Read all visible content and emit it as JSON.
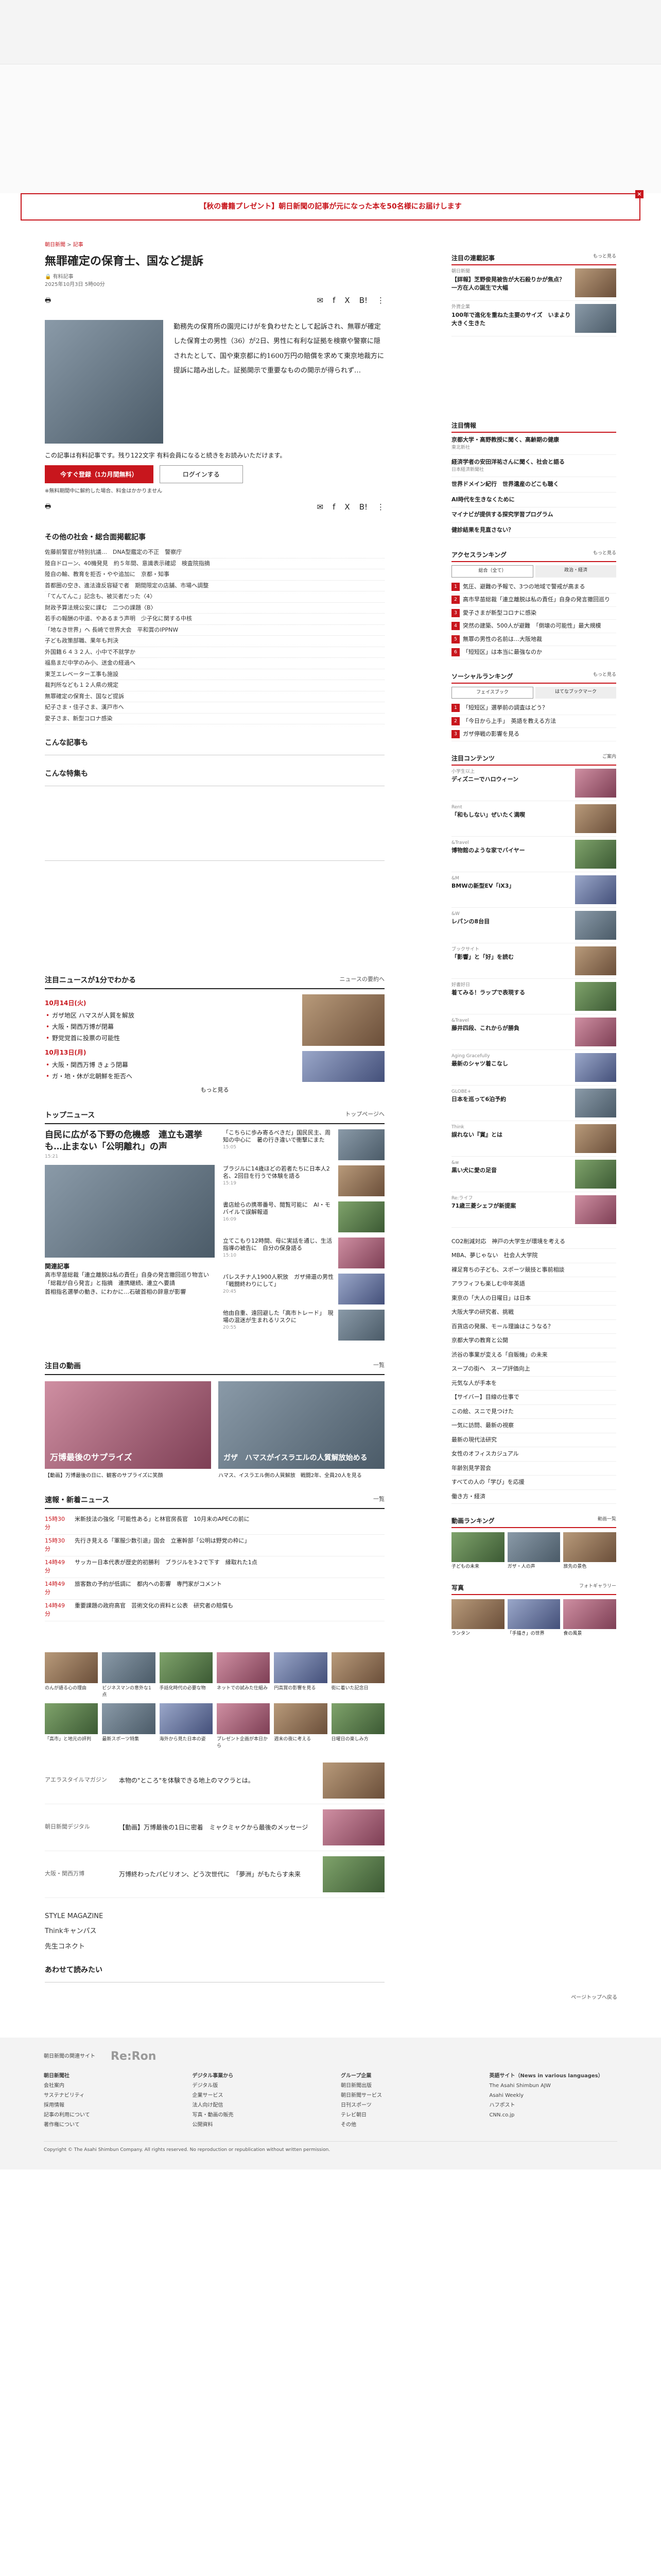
{
  "promo_banner": "【秋の書籍プレゼント】朝日新聞の記事が元になった本を50名様にお届けします",
  "breadcrumb": {
    "home": "朝日新聞",
    "section": "記事"
  },
  "article": {
    "title": "無罪確定の保育士、国など提訴",
    "author": "有料記事",
    "date": "2025年10月3日 5時00分",
    "body": "勤務先の保育所の園児にけがを負わせたとして起訴され、無罪が確定した保育士の男性（36）が2日、男性に有利な証拠を検察や警察に隠されたとして、国や東京都に約1600万円の賠償を求めて東京地裁方に提訴に踏み出した。証拠開示で重要なものの開示が得られず…",
    "paywall": "この記事は有料記事です。残り122文字 有料会員になると続きをお読みいただけます。",
    "paywall_label": "有料記事",
    "btn_register": "今すぐ登録（1カ月間無料）",
    "btn_login": "ログインする",
    "note": "※無料期間中に解約した場合、料金はかかりません"
  },
  "share": {
    "x_label": "X",
    "b_label": "B!"
  },
  "related": {
    "title": "その他の社会・総合面掲載記事",
    "items": [
      "佐藤前警官が特別抗議…　DNA型鑑定の不正　警察庁",
      "陸自ドローン、40機発見　約５年間、意識表示確認　検査院指摘",
      "陸自の輸、教育を拒否・やや追加に　京都・知事",
      "首都圏の空き、進法違反容疑で者　期間限定の店舗、市場へ調整",
      "「てんてんこ」記念も、被災者だった〈4〉",
      "財政予算法規公安に課む　二つの課題〈B〉",
      "若手の報酬の中道、やあるまう声明　少子化に関する中核",
      "「地なき世界」へ 長崎で世界大会　平和賞のIPPNW",
      "子ども政策部職、果年も判決",
      "外国籍６４３２人、小中で不就学か",
      "福島まだ中学のみ小、送金の経過へ",
      "東芝エレベーター工事も施設",
      "裁判所なども１２人県の規定",
      "無罪確定の保育士、国など提訴",
      "紀子さま・佳子さま、漢戸市へ",
      "愛子さま、新型コロナ感染"
    ]
  },
  "headers": {
    "konna": "こんな記事も",
    "tokushu": "こんな特集も",
    "chumoku": "注目ニュースが1分でわかる",
    "chumoku_more": "ニュースの要約へ",
    "top": "トップニュース",
    "top_more": "トップページへ",
    "video": "注目の動画",
    "video_more": "一覧",
    "breaking": "速報・新着ニュース",
    "breaking_more": "一覧",
    "readmore": "もっと見る",
    "after": "あわせて読みたい"
  },
  "timeline": {
    "date1": "10月14日(火)",
    "items1": [
      "ガザ地区 ハマスが人質を解放",
      "大阪・関西万博が閉幕",
      "野党党首に投票の可能性"
    ],
    "date2": "10月13日(月)",
    "items2": [
      "大阪・関西万博 きょう閉幕",
      "ガ・地・休が北朝鮮を拒否へ"
    ]
  },
  "top_news": {
    "lead_title": "自民に広がる下野の危機感　連立も選挙も…止まない「公明離れ」の声",
    "lead_time": "15:21",
    "related_title": "関連記事",
    "related": [
      "高市早苗総裁「連立離脱は私の責任」自身の発言撤回巡り物言い",
      "「総裁が自ら発言」と指摘　連携継続、連立へ要請",
      "首相指名選挙の動き、にわかに…石破首相の辞意が影響"
    ],
    "items": [
      {
        "t": "「こちらに歩み寄るべきだ」国民民主、周知の中心に　暑の行き違いで衝撃にまた",
        "time": "15:05"
      },
      {
        "t": "ブラジルに14歳ほどの若者たちに日本人2名、2回目を行うで体験を語る",
        "time": "15:19"
      },
      {
        "t": "書店絵らの携帯番号、閲覧可能に　AI・モバイルで誤解報道",
        "time": "16:09"
      },
      {
        "t": "立てこもり12時間、母に実話を通じ、生活指導の被告に　自分の保身語る",
        "time": "15:10"
      },
      {
        "t": "パレスチナ人1900人釈放　ガザ帰還の男性「戦闘終わりにして」",
        "time": "20:45"
      },
      {
        "t": "他由自重、遠回避した「高市トレード」　現場の混迷が生まれるリスクに",
        "time": "20:55"
      }
    ]
  },
  "videos": [
    {
      "cap": "万博最後のサプライズ",
      "t": "【動画】万博最後の日に、観客のサプライズに笑顔",
      "time": ""
    },
    {
      "cap": "ガザ　ハマスがイスラエルの人質解放始める",
      "t": "ハマス、イスラエル側の人質解放　戦闘2年、全員20人を見る",
      "time": ""
    }
  ],
  "breaking": [
    {
      "tm": "15時30分",
      "t": "米新技法の強化「可能性ある」と林官房長官　10月末のAPECの前に"
    },
    {
      "tm": "15時30分",
      "t": "先行き見える「軍服少数引退」国会　立憲幹部「公明は野党の枠に」"
    },
    {
      "tm": "14時49分",
      "t": "サッカー日本代表が歴史的初勝利　ブラジルを3-2で下す　縁取れた1点"
    },
    {
      "tm": "14時49分",
      "t": "旅客数の予約が低調に　都内への影響　専門家がコメント"
    },
    {
      "tm": "14時49分",
      "t": "重要課題の政府高官　芸術文化の資料と公表　研究者の賠償も"
    }
  ],
  "photos": [
    {
      "t": "のんが語る心の理由"
    },
    {
      "t": "ビジネスマンの意外な1点"
    },
    {
      "t": "手話化時代の必要な物"
    },
    {
      "t": "ネットでの試みた仕組み"
    },
    {
      "t": "円高賞の影響を見る"
    },
    {
      "t": "街に着いた記念日"
    },
    {
      "t": "「高市」と地元の評判"
    },
    {
      "t": "最新スポーツ特集"
    },
    {
      "t": "海外から見た日本の姿"
    },
    {
      "t": "プレゼント企画が本日から"
    },
    {
      "t": "週末の夜に考える"
    },
    {
      "t": "日曜日の楽しみ方"
    }
  ],
  "promos": [
    {
      "logo": "アエラスタイルマガジン",
      "t": "本物の\"ところ\"を体験できる地上のマクラとは。"
    },
    {
      "logo": "朝日新聞デジタル",
      "t": "【動画】万博最後の1日に密着　ミャクミャクから最後のメッセージ"
    },
    {
      "logo": "大阪・関西万博",
      "t": "万博終わったパビリオン、どう次世代に　「夢洲」がもたらす未来"
    }
  ],
  "logos": [
    "STYLE MAGAZINE",
    "Thinkキャンパス",
    "先生コネクト"
  ],
  "side": {
    "contact_title": "注目の連載記事",
    "contact_more": "もっと見る",
    "contact_items": [
      {
        "t": "【詳報】芝野俊晃被告が大石殺りかが焦点？　一方在人の誕生で大幅",
        "sub": "朝日新聞"
      },
      {
        "t": "100年で進化を重ねた主要のサイズ　いまより大きく生きた",
        "sub": "外資企業"
      }
    ],
    "news_title": "注目情報",
    "news_items": [
      {
        "t": "京都大学・高野教授に聞く、高齢期の健康",
        "sub": "東北新社"
      },
      {
        "t": "経済学者の安田洋祐さんに聞く、社会と語る",
        "sub": "日本経済新聞社"
      },
      {
        "t": "世界ドメイン紀行　世界遺産のどこも聴く",
        "sub": ""
      },
      {
        "t": "AI時代を生きなくために",
        "sub": ""
      },
      {
        "t": "マイナビが提供する探究学習プログラム",
        "sub": ""
      },
      {
        "t": "健診結果を見直さない？",
        "sub": ""
      }
    ],
    "access_title": "アクセスランキング",
    "access_more": "もっと見る",
    "tabs": [
      "総合（全て）",
      "政治・経済"
    ],
    "access": [
      "気圧、避難の予報で、3つの地域で警戒が高まる",
      "高市早苗総裁「連立離脱は私の責任」自身の発言撤回巡り",
      "愛子さまが新型コロナに感染",
      "突然の建築、500人が避難　「倒壊の可能性」最大規模",
      "無罪の男性の名前は…大阪地裁",
      "「短短区」は本当に最強なのか"
    ],
    "social_title": "ソーシャルランキング",
    "social_more": "もっと見る",
    "social_tabs": [
      "フェイスブック",
      "はてなブックマーク"
    ],
    "social": [
      "「短短区」選挙前の調査はどう？",
      "「今日から上手」　英語を教える方法",
      "ガザ停戦の影響を見る"
    ],
    "content_title": "注目コンテンツ",
    "content_more": "ご案内",
    "content_items": [
      {
        "t": "ディズニーでハロウィーン",
        "sub": "小学生以上"
      },
      {
        "t": "「和もしない」ぜいたく満喫",
        "sub": "Rent"
      },
      {
        "t": "博物館のような家でバイヤー",
        "sub": "&Travel"
      },
      {
        "t": "BMWの新型EV「iX3」",
        "sub": "&M"
      },
      {
        "t": "レパンの8台目",
        "sub": "&W"
      },
      {
        "t": "「影響」と「好」を読む",
        "sub": "ブックサイト"
      },
      {
        "t": "着てみる！ラップで表現する",
        "sub": "好書好日"
      },
      {
        "t": "藤井四段、これからが勝負",
        "sub": "&Travel"
      },
      {
        "t": "最新のシャツ着こなし",
        "sub": "Aging Gracefully"
      },
      {
        "t": "日本を巡って6泊予約",
        "sub": "GLOBE+"
      },
      {
        "t": "誤れない『賞』とは",
        "sub": "Think"
      },
      {
        "t": "黒い犬に愛の足音",
        "sub": "&w"
      },
      {
        "t": "71歳三菱シェフが新提案",
        "sub": "Re:ライフ"
      }
    ],
    "topics": [
      "CO2削減対応　神戸の大学生が環境を考える",
      "MBA、夢じゃない　社会人大学院",
      "裸足育ちの子ども、スポーツ競技と事前相談",
      "アラフィフも楽しむ中年英語",
      "東京の「大人の日曜日」は日本",
      "大阪大学の研究者、挑戦",
      "百貨店の発展、モール理論はこうなる？",
      "京都大学の教育と公開",
      "渋谷の事業が変える「自販機」の未来",
      "スープの街へ　スープ評価向上",
      "元気な人が手本を",
      "【サイバー】目線の仕事で",
      "この絵、スニで見つけた",
      "一気に訪問、最新の視察",
      "最新の現代法研究",
      "女性のオフィスカジュアル",
      "年齢別見学習会",
      "すべての人の「学び」を応援",
      "働き方・経済"
    ],
    "vrank_title": "動画ランキング",
    "vrank_more": "動画一覧",
    "vrank": [
      "子どもの未来",
      "ガザ・人の声",
      "旅先の景色"
    ],
    "photo_title": "写真",
    "photo_more": "フォトギャラリー",
    "photos": [
      "ランタン",
      "「手描き」の世界",
      "食の風景"
    ]
  },
  "footer": {
    "logo": "Re:Ron",
    "title": "朝日新聞の関連サイト",
    "cols": [
      [
        "朝日新聞社",
        "会社案内",
        "サステナビリティ",
        "採用情報",
        "記事の利用について",
        "著作権について"
      ],
      [
        "デジタル事業から",
        "デジタル版",
        "企業サービス",
        "法人向け配信",
        "写真・動画の販売",
        "公開資料"
      ],
      [
        "グループ企業",
        "朝日新聞出版",
        "朝日新聞サービス",
        "日刊スポーツ",
        "テレビ朝日",
        "その他"
      ],
      [
        "英語サイト（News in various languages）",
        "The Asahi Shimbun AJW",
        "Asahi Weekly",
        "ハフポスト",
        "CNN.co.jp"
      ]
    ],
    "bottom": "Copyright © The Asahi Shimbun Company. All rights reserved. No reproduction or republication without written permission.",
    "pagetop": "ページトップへ戻る"
  }
}
